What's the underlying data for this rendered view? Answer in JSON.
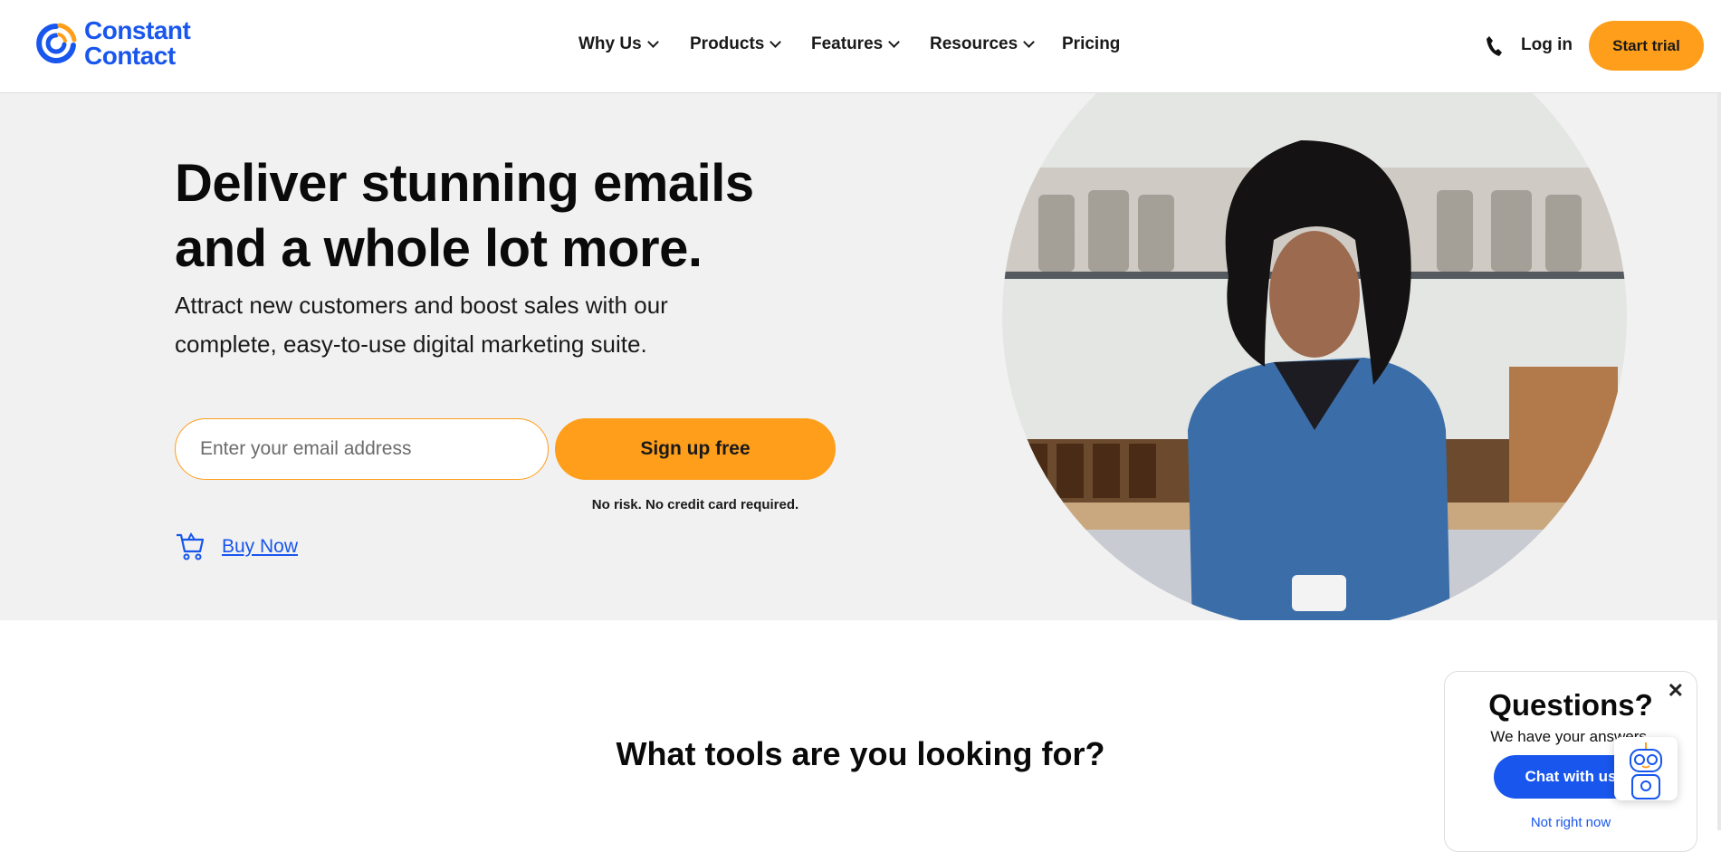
{
  "brand": {
    "name_line1": "Constant",
    "name_line2": "Contact",
    "color": "#1856ed",
    "accent": "#ff9e1b"
  },
  "nav": {
    "items": [
      {
        "label": "Why Us",
        "dropdown": true
      },
      {
        "label": "Products",
        "dropdown": true
      },
      {
        "label": "Features",
        "dropdown": true
      },
      {
        "label": "Resources",
        "dropdown": true
      },
      {
        "label": "Pricing",
        "dropdown": false
      }
    ],
    "phone_icon": "phone-icon",
    "login": "Log in",
    "start_trial": "Start trial"
  },
  "hero": {
    "headline_line1": "Deliver stunning emails",
    "headline_line2": "and a whole lot more.",
    "subtext": "Attract new customers and boost sales with our complete, easy-to-use digital marketing suite.",
    "email_placeholder": "Enter your email address",
    "signup": "Sign up free",
    "disclaimer": "No risk. No credit card required.",
    "buy_now": "Buy Now"
  },
  "section": {
    "title": "What tools are you looking for?"
  },
  "chat_popup": {
    "title": "Questions?",
    "subtitle": "We have your answers.",
    "chat_button": "Chat with us",
    "dismiss": "Not right now",
    "close": "✕"
  }
}
